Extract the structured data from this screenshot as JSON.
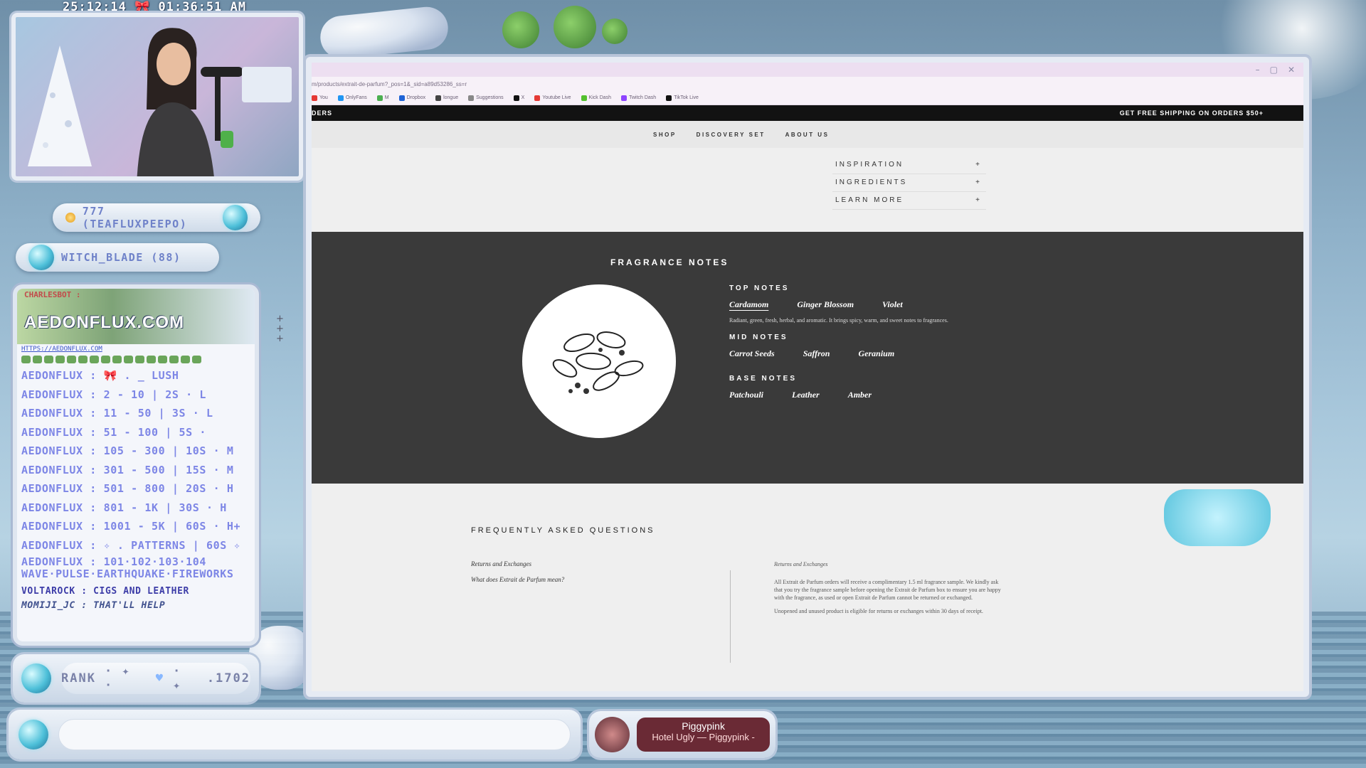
{
  "overlay": {
    "clock": "25:12:14 🎀 01:36:51 AM",
    "users": [
      {
        "label": "777 (TEAFLUXPEEPO)"
      },
      {
        "label": "WITCH_BLADE (88)"
      }
    ],
    "rank": {
      "label": "RANK",
      "value": ".1702"
    },
    "now_playing": {
      "title": "Piggypink",
      "subtitle": "Hotel Ugly — Piggypink -"
    }
  },
  "chat": {
    "banner_top": "CHARLESBOT :",
    "brand": "AEDONFLUX.COM",
    "link": "HTTPS://AEDONFLUX.COM",
    "lines": [
      "AEDONFLUX : 🎀 . _ LUSH",
      "AEDONFLUX : 2 - 10 | 2S · L",
      "AEDONFLUX : 11 - 50 | 3S · L",
      "AEDONFLUX : 51 - 100 | 5S ·",
      "AEDONFLUX : 105 - 300 | 10S · M",
      "AEDONFLUX : 301 - 500 | 15S · M",
      "AEDONFLUX : 501 - 800 | 20S · H",
      "AEDONFLUX : 801 - 1K | 30S · H",
      "AEDONFLUX : 1001 - 5K | 60S · H+"
    ],
    "line_patterns": "AEDONFLUX : ✧ . PATTERNS | 60S ✧",
    "line_effects": "AEDONFLUX : 101·102·103·104 WAVE·PULSE·EARTHQUAKE·FIREWORKS",
    "line_volta": "VOLTAROCK : CIGS AND LEATHER",
    "line_momiji": "MOMIJI_JC : THAT'LL HELP"
  },
  "browser": {
    "url": "m/products/extrait-de-parfum?_pos=1&_sid=a89d53286_ss=r",
    "bookmarks": [
      {
        "label": "You",
        "color": "#e53935"
      },
      {
        "label": "OnlyFans",
        "color": "#2196f3"
      },
      {
        "label": "M",
        "color": "#4caf50"
      },
      {
        "label": "Dropbox",
        "color": "#1e63d6"
      },
      {
        "label": "longue",
        "color": "#444"
      },
      {
        "label": "Suggestions",
        "color": "#888"
      },
      {
        "label": "X",
        "color": "#111"
      },
      {
        "label": "Youtube Live",
        "color": "#e53935"
      },
      {
        "label": "Kick Dash",
        "color": "#53c02e"
      },
      {
        "label": "Twitch Dash",
        "color": "#8e44ff"
      },
      {
        "label": "TikTok Live",
        "color": "#111"
      }
    ],
    "announce_left": "DERS",
    "announce_right": "GET FREE SHIPPING ON ORDERS $50+",
    "nav": [
      "SHOP",
      "DISCOVERY SET",
      "ABOUT US"
    ],
    "accordion": [
      {
        "label": "INSPIRATION",
        "icon": "+"
      },
      {
        "label": "INGREDIENTS",
        "icon": "+"
      },
      {
        "label": "LEARN MORE",
        "icon": "+"
      }
    ],
    "fragrance": {
      "title": "FRAGRANCE NOTES",
      "top_head": "TOP NOTES",
      "top": [
        "Cardamom",
        "Ginger Blossom",
        "Violet"
      ],
      "top_desc": "Radiant, green, fresh, herbal, and aromatic. It brings spicy, warm, and sweet notes to fragrances.",
      "mid_head": "MID NOTES",
      "mid": [
        "Carrot Seeds",
        "Saffron",
        "Geranium"
      ],
      "base_head": "BASE NOTES",
      "base": [
        "Patchouli",
        "Leather",
        "Amber"
      ]
    },
    "faq": {
      "title": "FREQUENTLY ASKED QUESTIONS",
      "left_q1": "Returns and Exchanges",
      "left_q2": "What does Extrait de Parfum mean?",
      "right_head": "Returns and Exchanges",
      "right_p1": "All Extrait de Parfum orders will receive a complimentary 1.5 ml fragrance sample. We kindly ask that you try the fragrance sample before opening the Extrait de Parfum box to ensure you are happy with the fragrance, as used or open Extrait de Parfum cannot be returned or exchanged.",
      "right_p2": "Unopened and unused product is eligible for returns or exchanges within 30 days of receipt."
    }
  }
}
